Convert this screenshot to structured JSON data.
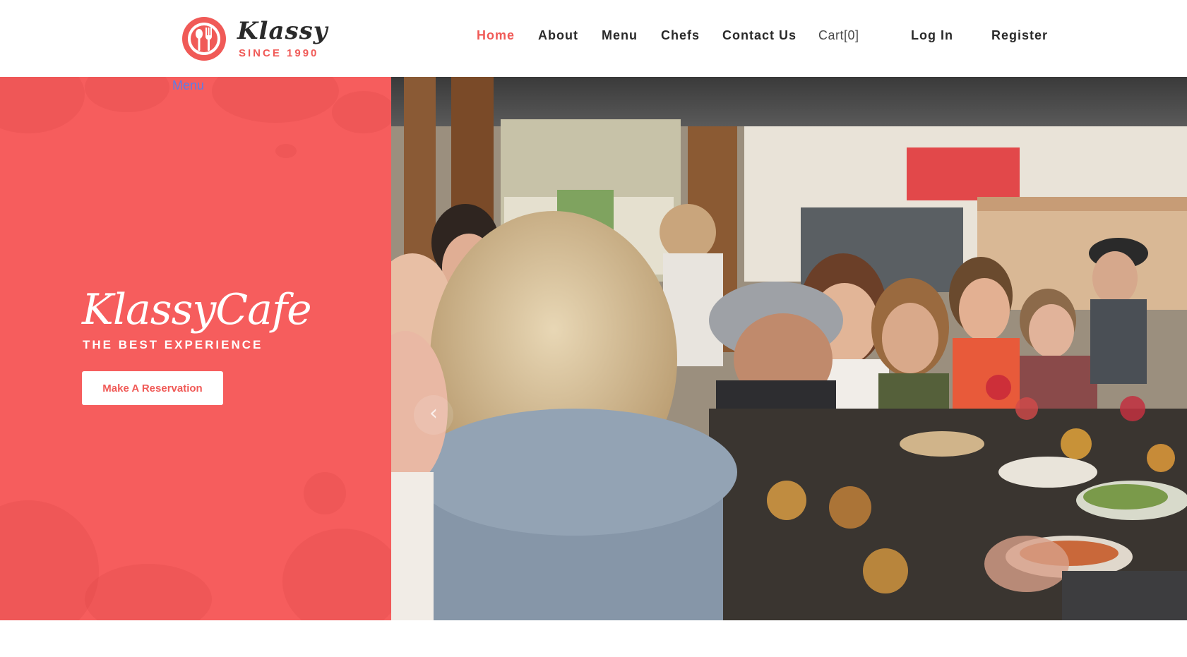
{
  "header": {
    "logo": {
      "name": "Klassy",
      "since": "SINCE 1990",
      "icon": "spoon-fork-icon"
    },
    "nav": [
      {
        "label": "Home",
        "active": true
      },
      {
        "label": "About",
        "active": false
      },
      {
        "label": "Menu",
        "active": false
      },
      {
        "label": "Chefs",
        "active": false
      },
      {
        "label": "Contact Us",
        "active": false
      },
      {
        "label": "Cart[0]",
        "active": false
      },
      {
        "label": "Log In",
        "active": false
      },
      {
        "label": "Register",
        "active": false
      }
    ],
    "menu_toggle": "Menu"
  },
  "hero": {
    "title": "KlassyCafe",
    "subtitle": "THE BEST EXPERIENCE",
    "cta_label": "Make A Reservation",
    "prev_icon": "chevron-left-icon",
    "photo": "restaurant-diners-photo"
  },
  "colors": {
    "accent": "#f05a57",
    "hero_panel": "#f65d5d",
    "menu_link": "#5b7de8",
    "text_dark": "#2a2a2a"
  }
}
